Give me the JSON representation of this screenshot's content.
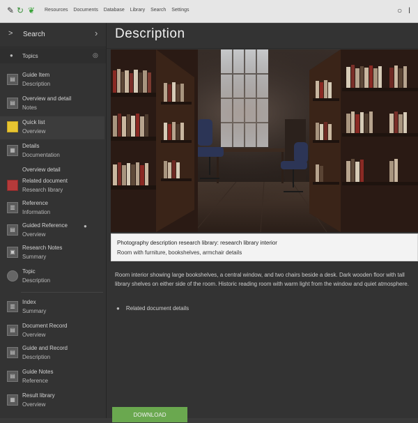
{
  "topbar": {
    "menu": [
      "Resources",
      "Documents",
      "Database",
      "Library",
      "Search",
      "Settings"
    ]
  },
  "sidebar": {
    "title": "Search",
    "filter_label": "Topics",
    "items": [
      {
        "l1": "Guide Item",
        "l2": "Description"
      },
      {
        "l1": "Overview and detail",
        "l2": "Notes"
      },
      {
        "l1": "Quick list",
        "l2": "Overview"
      },
      {
        "l1": "Details",
        "l2": "Documentation"
      },
      {
        "l1": "Overview detail",
        "l2": ""
      },
      {
        "l1": "Related document",
        "l2": "Research library"
      },
      {
        "l1": "Reference",
        "l2": "Information"
      },
      {
        "l1": "Guided Reference",
        "l2": "Overview"
      },
      {
        "l1": "Research Notes",
        "l2": "Summary"
      },
      {
        "l1": "Topic",
        "l2": "Description"
      },
      {
        "l1": "Index",
        "l2": "Summary"
      },
      {
        "l1": "Document Record",
        "l2": "Overview"
      },
      {
        "l1": "Guide and Record",
        "l2": "Description"
      },
      {
        "l1": "Guide Notes",
        "l2": "Reference"
      },
      {
        "l1": "Result library",
        "l2": "Overview"
      }
    ]
  },
  "main": {
    "title": "Description",
    "caption_line1": "Photography description research library: research library interior",
    "caption_line2": "Room with furniture, bookshelves, armchair details",
    "body": "Room interior showing large bookshelves, a central window, and two chairs beside a desk. Dark wooden floor with tall library shelves on either side of the room. Historic reading room with warm light from the window and quiet atmosphere.",
    "bullet": "Related document details",
    "download_label": "DOWNLOAD"
  },
  "colors": {
    "accent": "#6aa84f",
    "sidebar_bg": "#333333",
    "topbar_bg": "#e6e6e6"
  }
}
